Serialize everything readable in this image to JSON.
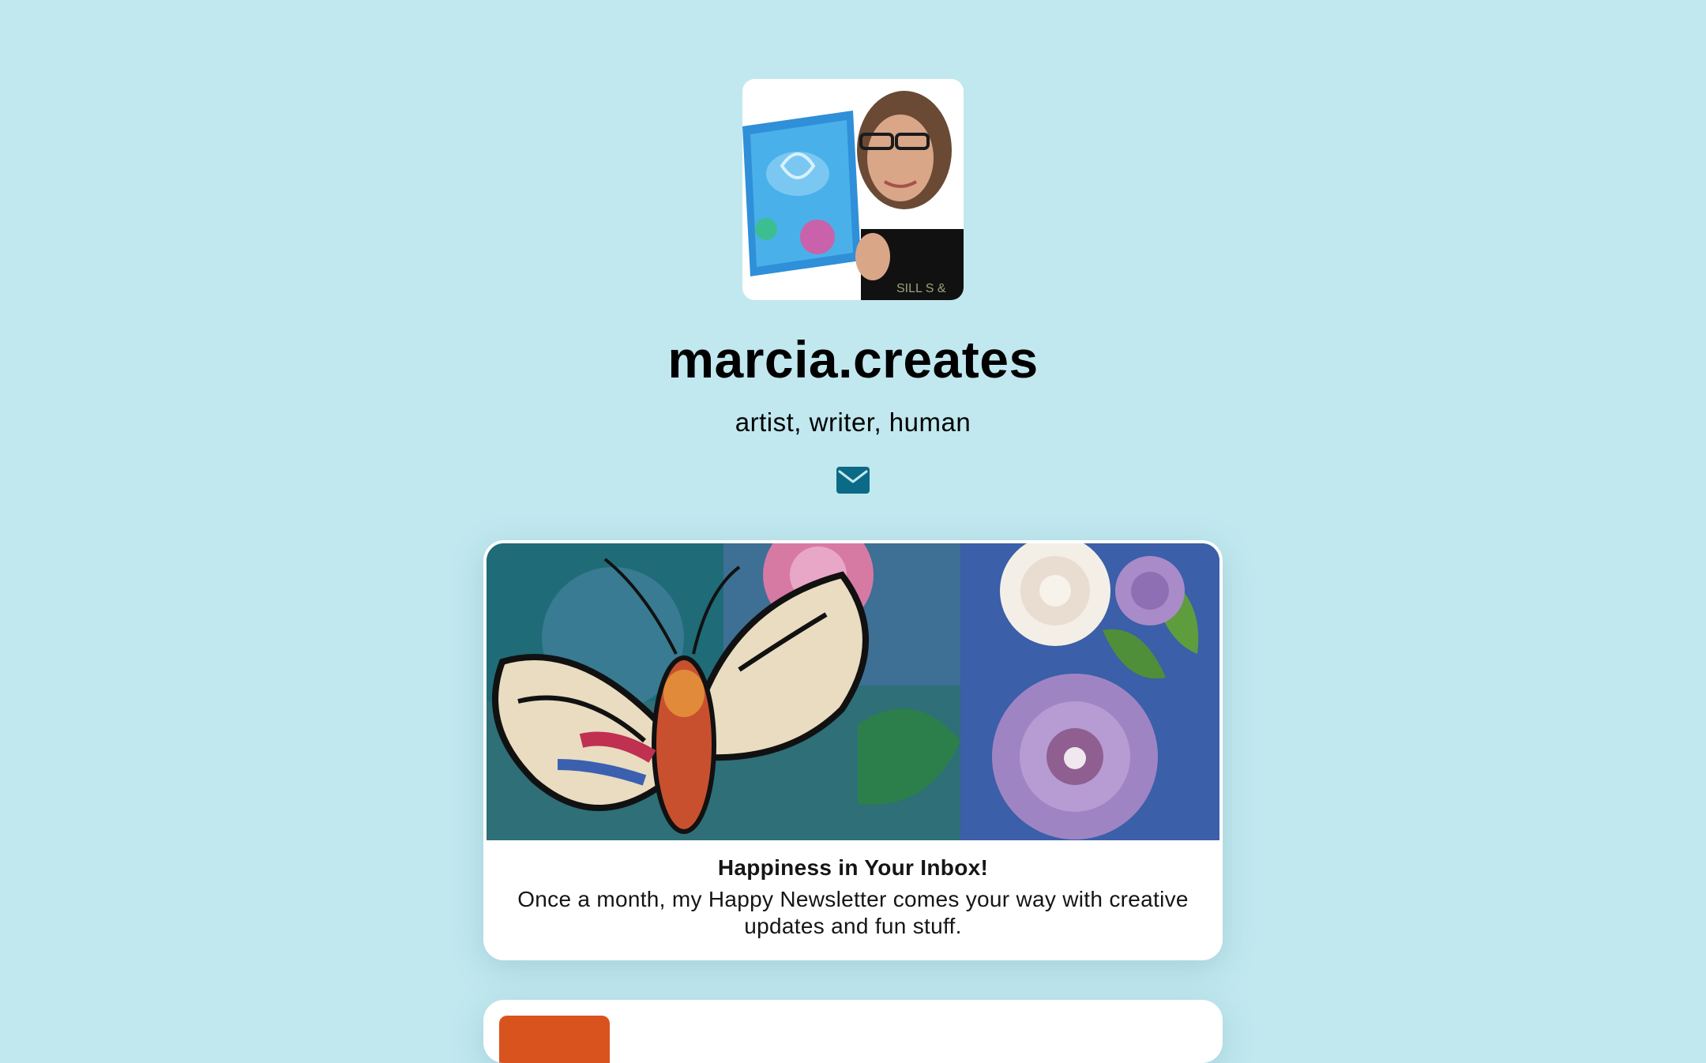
{
  "profile": {
    "name": "marcia.creates",
    "bio": "artist, writer, human"
  },
  "social": {
    "email_icon": "envelope-icon"
  },
  "links": [
    {
      "title": "Happiness in Your Inbox!",
      "description": "Once a month, my Happy Newsletter comes your way with creative updates and fun stuff."
    }
  ],
  "colors": {
    "background": "#c1e8ef",
    "card": "#ffffff",
    "icon": "#0b6a86",
    "text": "#000000"
  }
}
